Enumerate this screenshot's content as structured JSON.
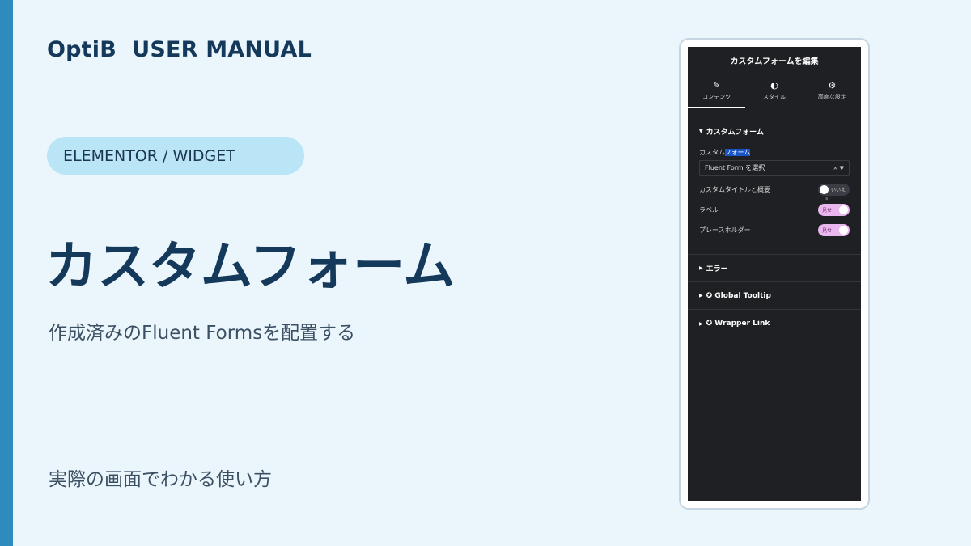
{
  "slide": {
    "brand": "OptiB  USER MANUAL",
    "category": "ELEMENTOR / WIDGET",
    "title": "カスタムフォーム",
    "subtitle": "作成済みのFluent Formsを配置する",
    "footer": "実際の画面でわかる使い方"
  },
  "panel": {
    "header": "カスタムフォームを編集",
    "tabs": [
      {
        "label": "コンテンツ",
        "icon": "pencil-icon",
        "active": true
      },
      {
        "label": "スタイル",
        "icon": "half-circle-icon",
        "active": false
      },
      {
        "label": "高度な設定",
        "icon": "gear-icon",
        "active": false
      }
    ],
    "section_form": {
      "title": "カスタムフォーム",
      "field_label_prefix": "カスタム",
      "field_label_highlight": "フォーム",
      "select_value": "Fluent Form を選択",
      "select_clear": "×",
      "rows": [
        {
          "label": "カスタムタイトルと概要",
          "toggle_text": "いいえ",
          "state": "off"
        },
        {
          "label": "ラベル",
          "toggle_text": "見せ",
          "state": "on",
          "hint": "s"
        },
        {
          "label": "プレースホルダー",
          "toggle_text": "見せ",
          "state": "on"
        }
      ]
    },
    "collapsed_sections": [
      {
        "title": "エラー"
      },
      {
        "title": "✪ Global Tooltip"
      },
      {
        "title": "✪ Wrapper Link"
      }
    ]
  },
  "colors": {
    "background": "#eaf5fc",
    "accent_bar": "#2e8bbd",
    "title": "#15395a",
    "pill": "#b9e5f7",
    "panel_bg": "#1f2024",
    "toggle_on": "#e9b6ee"
  }
}
